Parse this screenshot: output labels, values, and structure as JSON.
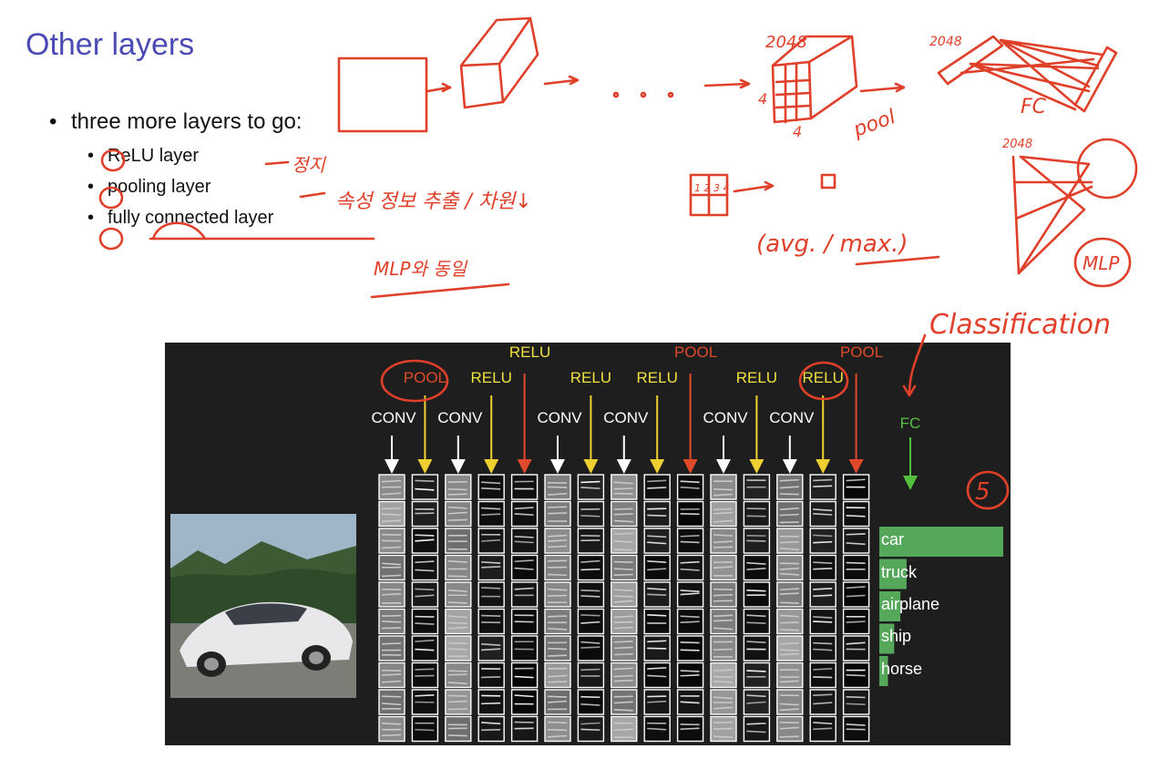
{
  "slide": {
    "title": "Other layers",
    "bullet": "three more layers to go:",
    "sub_items": [
      "ReLU layer",
      "pooling layer",
      "fully connected layer"
    ]
  },
  "figure": {
    "top_labels": [
      {
        "text": "POOL",
        "color": "#e04a2a"
      },
      {
        "text": "RELU",
        "color": "#f0e040"
      },
      {
        "text": "RELU",
        "color": "#f0e040"
      },
      {
        "text": "RELU",
        "color": "#f0e040"
      },
      {
        "text": "RELU",
        "color": "#f0e040"
      },
      {
        "text": "POOL",
        "color": "#e04a2a"
      },
      {
        "text": "RELU",
        "color": "#f0e040"
      },
      {
        "text": "RELU",
        "color": "#f0e040"
      },
      {
        "text": "POOL",
        "color": "#e04a2a"
      }
    ],
    "conv_labels": [
      "CONV",
      "CONV",
      "CONV",
      "CONV",
      "CONV",
      "CONV"
    ],
    "fc_label": "FC",
    "classes": [
      "car",
      "truck",
      "airplane",
      "ship",
      "horse"
    ],
    "class_scores": [
      1.0,
      0.22,
      0.17,
      0.12,
      0.07
    ],
    "bar_color": "#55a85a"
  },
  "annotations": {
    "relu_note": "정지",
    "pooling_note": "속성 정보 추출 / 차원↓",
    "mlp_note": "MLP와 동일",
    "avg_max": "(avg. / max.)",
    "pool": "pool",
    "fc": "FC",
    "mlp": "MLP",
    "classification": "Classification",
    "n2048": "2048",
    "n2048b": "2048",
    "n2048c": "2048",
    "four": "4",
    "five": "5",
    "grid": "1 2 3 4"
  }
}
